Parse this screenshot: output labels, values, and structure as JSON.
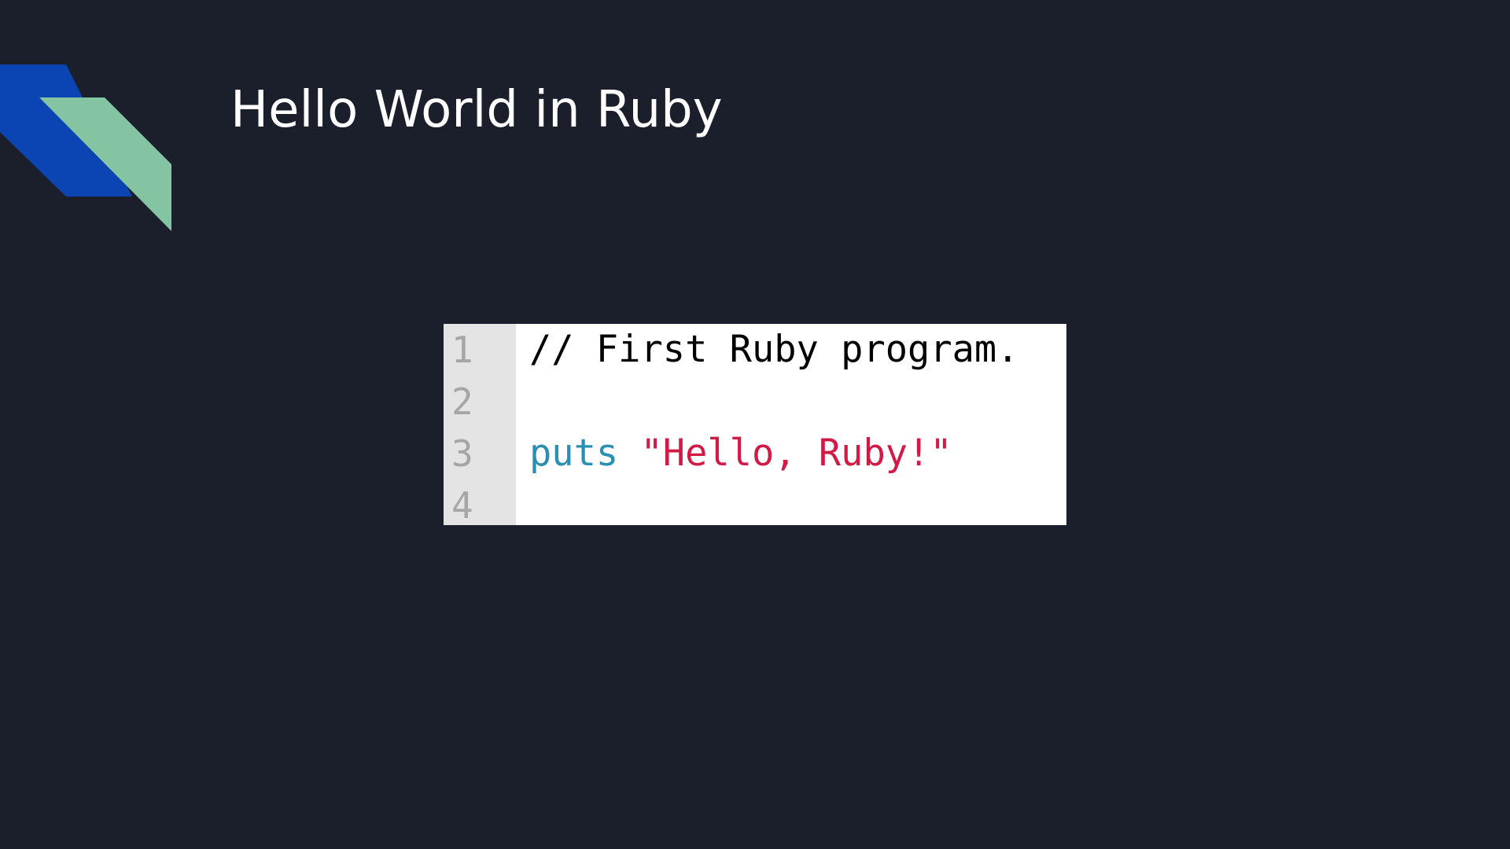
{
  "slide": {
    "title": "Hello World in Ruby",
    "accent_colors": {
      "dark_stripe": "#0b45b4",
      "light_stripe": "#84c4a3",
      "background": "#1b1f2c"
    }
  },
  "code_block": {
    "line_numbers": [
      "1",
      "2",
      "3",
      "4"
    ],
    "line1_comment": "// First Ruby program.",
    "line3_keyword": "puts",
    "line3_string": "\"Hello, Ruby!\"",
    "colors": {
      "keyword": "#2a8fb3",
      "string": "#d21a47",
      "comment": "#000000",
      "gutter": "#e4e4e4",
      "line_number": "#a6a6a6"
    }
  }
}
